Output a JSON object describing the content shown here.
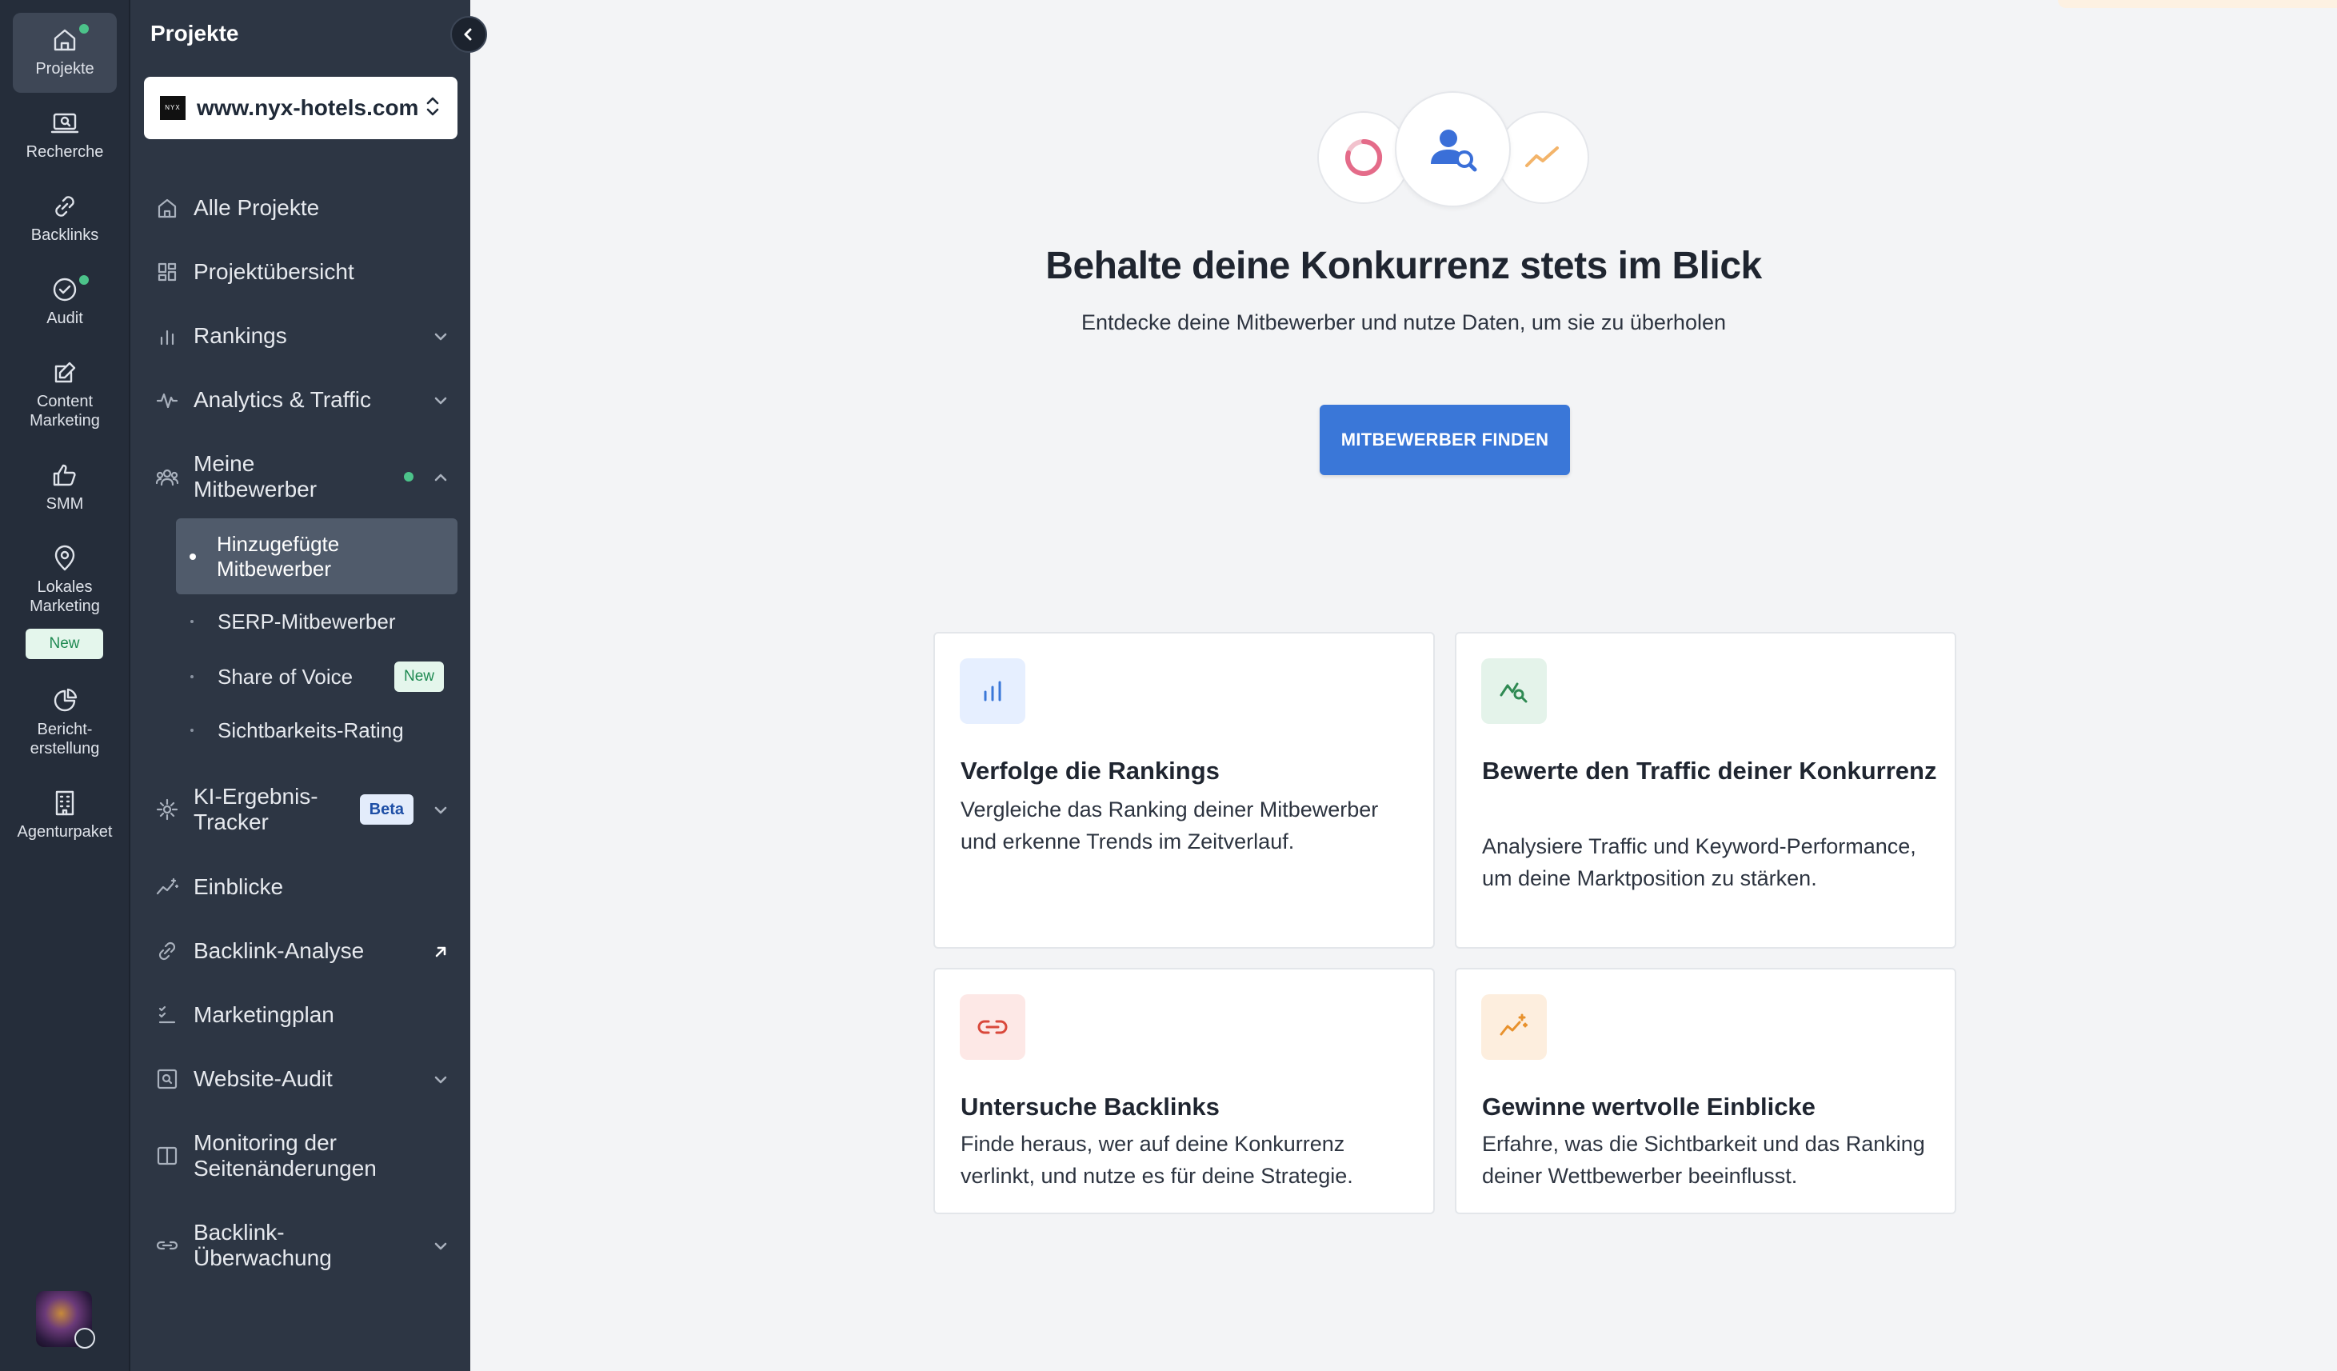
{
  "rail": {
    "items": [
      {
        "label": "Projekte",
        "icon": "home-icon"
      },
      {
        "label": "Recherche",
        "icon": "research-icon"
      },
      {
        "label": "Backlinks",
        "icon": "link-icon"
      },
      {
        "label": "Audit",
        "icon": "check-circle-icon"
      },
      {
        "label": "Content Marketing",
        "icon": "edit-icon"
      },
      {
        "label": "SMM",
        "icon": "thumbs-up-icon"
      },
      {
        "label": "Lokales Marketing",
        "icon": "location-pin-icon"
      },
      {
        "label": "Bericht-erstellung",
        "icon": "pie-chart-icon"
      },
      {
        "label": "Agenturpaket",
        "icon": "building-icon"
      }
    ],
    "new_badge": "New"
  },
  "panel": {
    "title": "Projekte",
    "project": {
      "domain": "www.nyx-hotels.com",
      "logo_text": "NYX"
    },
    "nav": [
      {
        "label": "Alle Projekte",
        "icon": "home-icon"
      },
      {
        "label": "Projektübersicht",
        "icon": "dashboard-icon"
      },
      {
        "label": "Rankings",
        "icon": "bar-chart-icon"
      },
      {
        "label": "Analytics & Traffic",
        "icon": "pulse-icon"
      },
      {
        "label": "Meine Mitbewerber",
        "icon": "users-icon"
      },
      {
        "label": "KI-Ergebnis-Tracker",
        "icon": "ai-icon",
        "badge": "Beta"
      },
      {
        "label": "Einblicke",
        "icon": "sparkle-trend-icon"
      },
      {
        "label": "Backlink-Analyse",
        "icon": "link-icon"
      },
      {
        "label": "Marketingplan",
        "icon": "checklist-icon"
      },
      {
        "label": "Website-Audit",
        "icon": "search-square-icon"
      },
      {
        "label": "Monitoring der Seitenänderungen",
        "icon": "columns-icon"
      },
      {
        "label": "Backlink-Überwachung",
        "icon": "link-watch-icon"
      }
    ],
    "sub_items": [
      {
        "label": "Hinzugefügte Mitbewerber",
        "active": true
      },
      {
        "label": "SERP-Mitbewerber"
      },
      {
        "label": "Share of Voice",
        "badge": "New"
      },
      {
        "label": "Sichtbarkeits-Rating"
      }
    ]
  },
  "hero": {
    "title": "Behalte deine Konkurrenz stets im Blick",
    "subtitle": "Entdecke deine Mitbewerber und nutze Daten, um sie zu überholen",
    "cta": "MITBEWERBER FINDEN",
    "icons": [
      "donut-icon",
      "user-search-icon",
      "trend-up-icon"
    ]
  },
  "cards": [
    {
      "title": "Verfolge die Rankings",
      "text": "Vergleiche das Ranking deiner Mitbewerber und erkenne Trends im Zeitverlauf.",
      "icon": "bar-chart-icon",
      "icon_bg": "#e6efff",
      "icon_color": "#3a77d8"
    },
    {
      "title": "Bewerte den Traffic deiner Konkurrenz",
      "text": "Analysiere Traffic und Keyword-Performance, um deine Marktposition zu stärken.",
      "icon": "trend-search-icon",
      "icon_bg": "#e4f3ea",
      "icon_color": "#2f8a53"
    },
    {
      "title": "Untersuche Backlinks",
      "text": "Finde heraus, wer auf deine Konkurrenz verlinkt, und nutze es für deine Strategie.",
      "icon": "link-icon",
      "icon_bg": "#fde8e6",
      "icon_color": "#d9483b"
    },
    {
      "title": "Gewinne wertvolle Einblicke",
      "text": "Erfahre, was die Sichtbarkeit und das Ranking deiner Wettbewerber beeinflusst.",
      "icon": "sparkle-trend-icon",
      "icon_bg": "#fdeede",
      "icon_color": "#e8912c"
    }
  ]
}
